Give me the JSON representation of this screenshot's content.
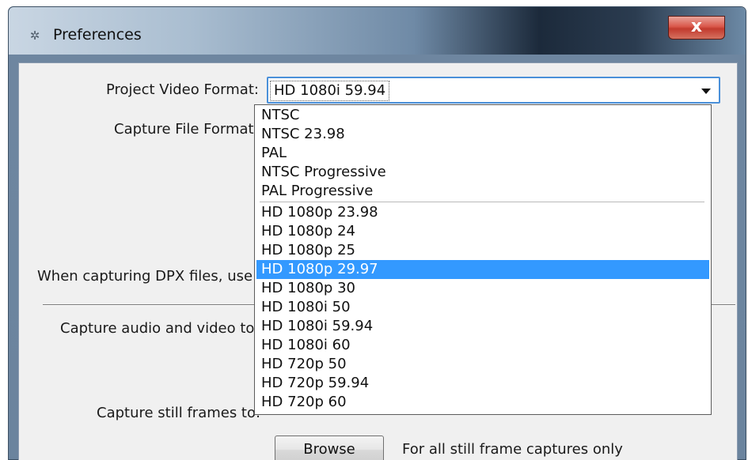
{
  "window": {
    "title": "Preferences",
    "close_glyph": "x",
    "icon": "gear-icon"
  },
  "form": {
    "project_video_format_label": "Project Video Format:",
    "capture_file_format_label": "Capture File Format:",
    "dpx_label": "When capturing DPX files, use",
    "capture_audio_video_label": "Capture audio and video to:",
    "capture_still_label": "Capture still frames to:",
    "browse_label": "Browse",
    "browse_note": "For all still frame captures only"
  },
  "project_video_format": {
    "selected_value": "HD 1080i 59.94",
    "options": [
      "NTSC",
      "NTSC 23.98",
      "PAL",
      "NTSC Progressive",
      "PAL Progressive",
      "HD 1080p 23.98",
      "HD 1080p 24",
      "HD 1080p 25",
      "HD 1080p 29.97",
      "HD 1080p 30",
      "HD 1080i 50",
      "HD 1080i 59.94",
      "HD 1080i 60",
      "HD 720p 50",
      "HD 720p 59.94",
      "HD 720p 60"
    ],
    "highlighted_option": "HD 1080p 29.97"
  },
  "colors": {
    "highlight": "#3399ff",
    "focus_border": "#4a90d9",
    "close_button": "#c8493c"
  }
}
